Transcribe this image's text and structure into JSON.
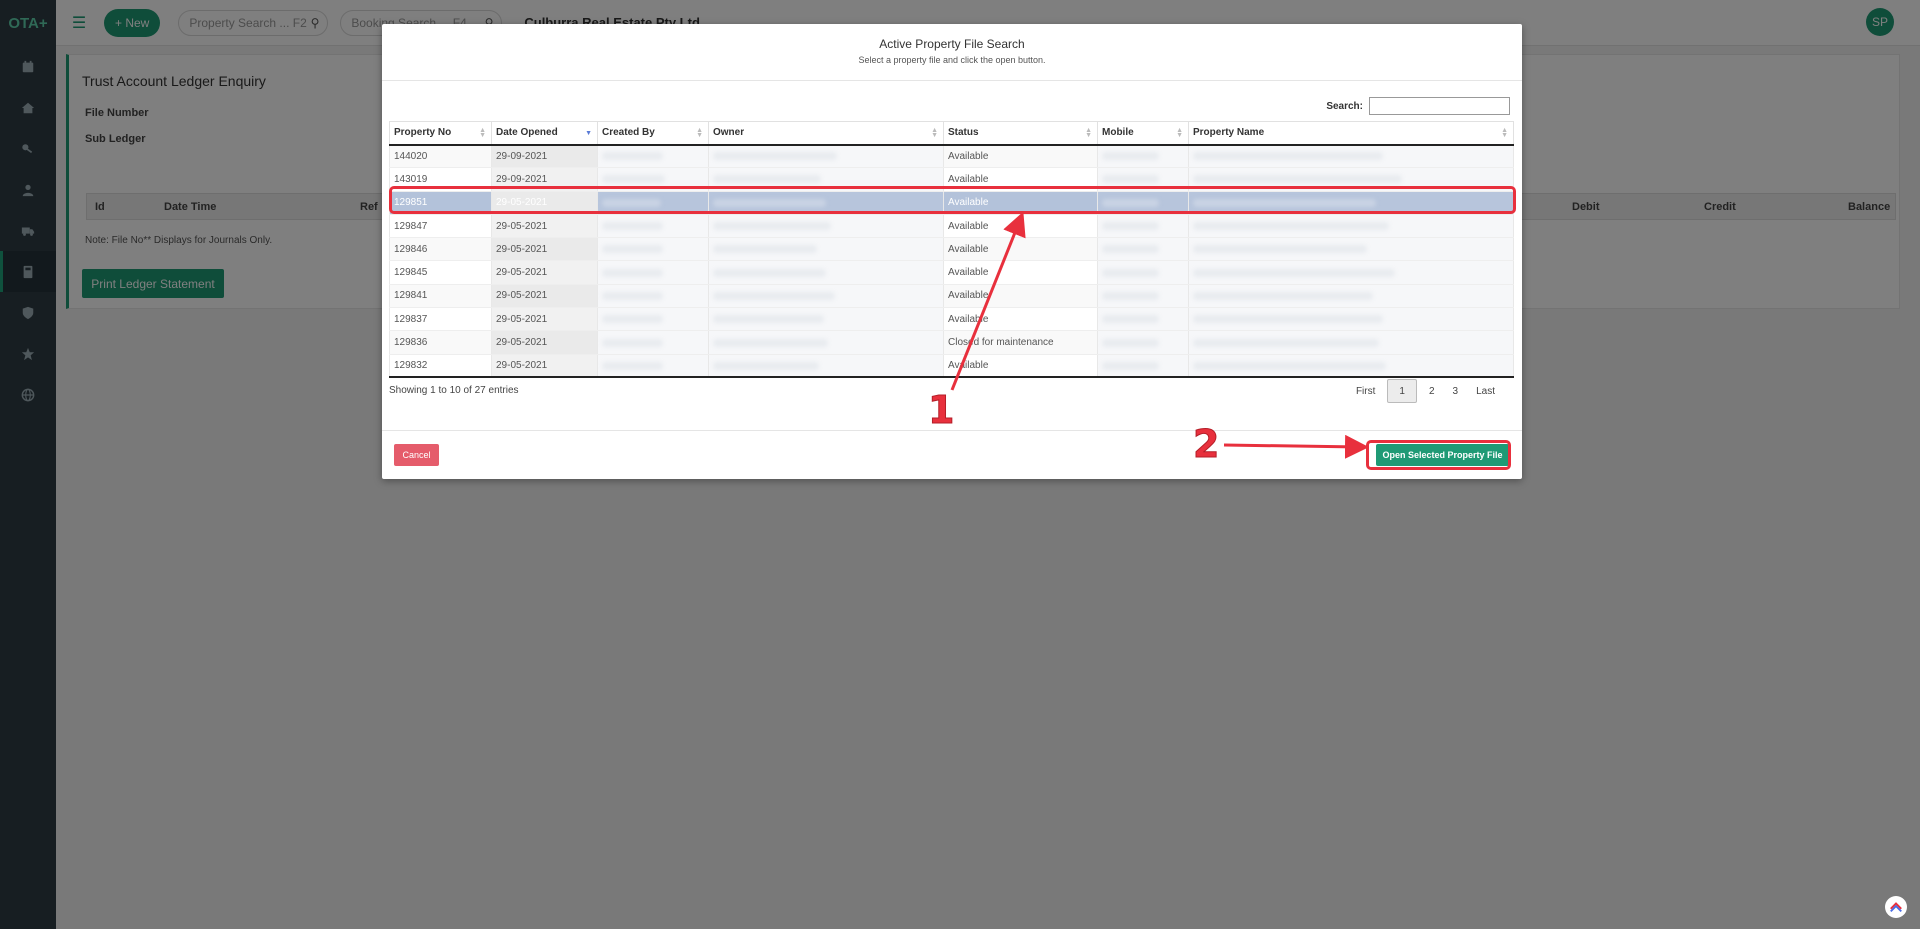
{
  "app": {
    "brand": "OTA+",
    "new_label": "+ New",
    "property_search_placeholder": "Property Search ... F2",
    "booking_search_placeholder": "Booking Search ... F4",
    "company": "Culburra Real Estate Pty Ltd",
    "avatar": "SP"
  },
  "sidebar": {
    "items": [
      {
        "icon": "calendar-icon"
      },
      {
        "icon": "home-icon"
      },
      {
        "icon": "key-icon"
      },
      {
        "icon": "user-icon"
      },
      {
        "icon": "truck-icon"
      },
      {
        "icon": "calculator-icon",
        "active": true
      },
      {
        "icon": "shield-icon"
      },
      {
        "icon": "star-icon"
      },
      {
        "icon": "globe-icon"
      }
    ]
  },
  "page": {
    "title": "Trust Account Ledger Enquiry",
    "file_number_label": "File Number",
    "sub_ledger_label": "Sub Ledger",
    "columns": {
      "id": "Id",
      "date_time": "Date Time",
      "ref": "Ref",
      "debit": "Debit",
      "credit": "Credit",
      "balance": "Balance"
    },
    "note": "Note: File No** Displays for Journals Only.",
    "print_label": "Print Ledger Statement"
  },
  "modal": {
    "title": "Active Property File Search",
    "subtitle": "Select a property file and click the open button.",
    "search_label": "Search:",
    "search_value": "",
    "headers": [
      "Property No",
      "Date Opened",
      "Created By",
      "Owner",
      "Status",
      "Mobile",
      "Property Name"
    ],
    "rows": [
      {
        "property_no": "144020",
        "date_opened": "29-09-2021",
        "status": "Available"
      },
      {
        "property_no": "143019",
        "date_opened": "29-09-2021",
        "status": "Available"
      },
      {
        "property_no": "129851",
        "date_opened": "29-05-2021",
        "status": "Available",
        "selected": true
      },
      {
        "property_no": "129847",
        "date_opened": "29-05-2021",
        "status": "Available"
      },
      {
        "property_no": "129846",
        "date_opened": "29-05-2021",
        "status": "Available"
      },
      {
        "property_no": "129845",
        "date_opened": "29-05-2021",
        "status": "Available"
      },
      {
        "property_no": "129841",
        "date_opened": "29-05-2021",
        "status": "Available"
      },
      {
        "property_no": "129837",
        "date_opened": "29-05-2021",
        "status": "Available"
      },
      {
        "property_no": "129836",
        "date_opened": "29-05-2021",
        "status": "Closed for maintenance"
      },
      {
        "property_no": "129832",
        "date_opened": "29-05-2021",
        "status": "Available"
      }
    ],
    "info": "Showing 1 to 10 of 27 entries",
    "pager": {
      "first": "First",
      "pages": [
        "1",
        "2",
        "3"
      ],
      "current": "1",
      "last": "Last"
    },
    "cancel_label": "Cancel",
    "open_label": "Open Selected Property File"
  },
  "annotations": {
    "step1": "1",
    "step2": "2",
    "color": "#e8303d"
  }
}
